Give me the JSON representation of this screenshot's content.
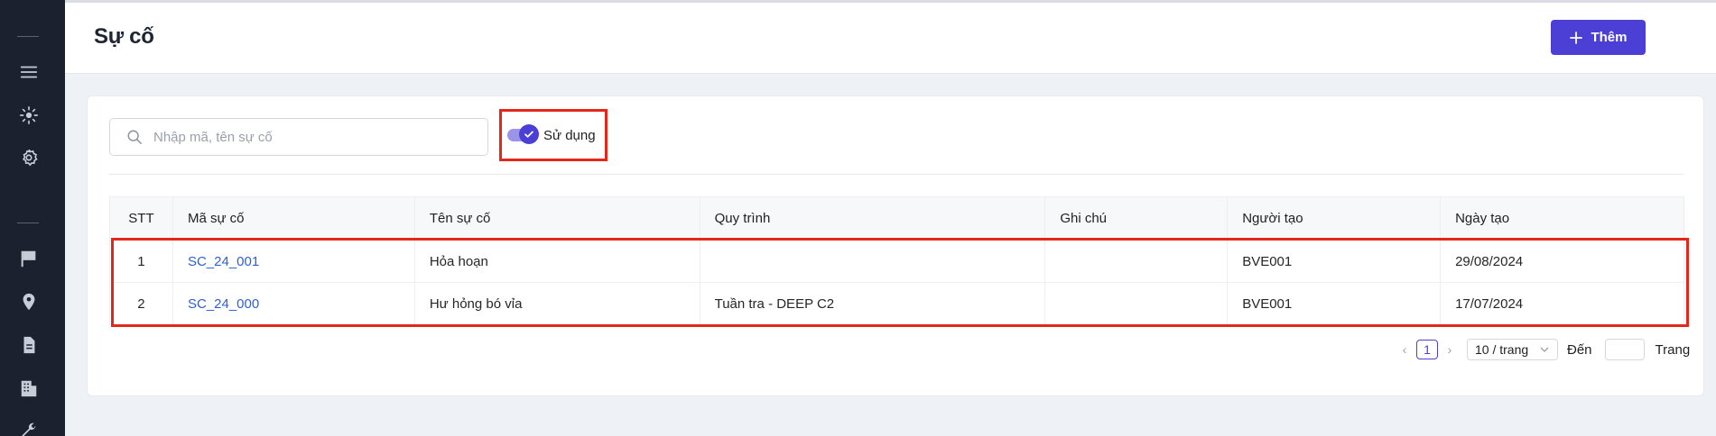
{
  "header": {
    "title": "Sự cố",
    "add_label": "Thêm"
  },
  "sidebar": {
    "items": [
      {
        "icon": "menu-icon"
      },
      {
        "icon": "scan-icon"
      },
      {
        "icon": "gear-icon"
      },
      {
        "icon": "flag-icon"
      },
      {
        "icon": "location-pin-icon"
      },
      {
        "icon": "document-icon"
      },
      {
        "icon": "building-icon"
      },
      {
        "icon": "wrench-icon"
      }
    ]
  },
  "filters": {
    "search_placeholder": "Nhập mã, tên sự cố",
    "search_value": "",
    "toggle_label": "Sử dụng",
    "toggle_on": true
  },
  "table": {
    "columns": [
      "STT",
      "Mã sự cố",
      "Tên sự cố",
      "Quy trình",
      "Ghi chú",
      "Người tạo",
      "Ngày tạo"
    ],
    "rows": [
      {
        "stt": "1",
        "code": "SC_24_001",
        "name": "Hỏa hoạn",
        "process": "",
        "note": "",
        "creator": "BVE001",
        "date": "29/08/2024"
      },
      {
        "stt": "2",
        "code": "SC_24_000",
        "name": "Hư hỏng bó vỉa",
        "process": "Tuần tra - DEEP C2",
        "note": "",
        "creator": "BVE001",
        "date": "17/07/2024"
      }
    ]
  },
  "pagination": {
    "current_page": "1",
    "page_size": "10 / trang",
    "goto_label": "Đến",
    "page_label": "Trang"
  },
  "colors": {
    "primary": "#4b3fd6",
    "sidebar_bg": "#1c2130",
    "link": "#2f5fd0",
    "highlight_border": "#e5261b"
  }
}
